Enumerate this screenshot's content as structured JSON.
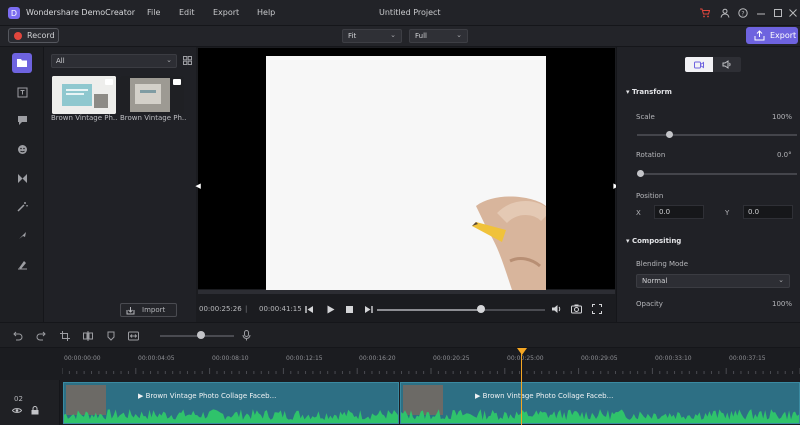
{
  "app": {
    "name": "Wondershare DemoCreator",
    "logo_letter": "D"
  },
  "menu": [
    "File",
    "Edit",
    "Export",
    "Help"
  ],
  "window": {
    "title": "Untitled Project"
  },
  "toolbar": {
    "record_label": "Record",
    "fit_value": "Fit",
    "quality_value": "Full",
    "export_label": "Export"
  },
  "media": {
    "filter_value": "All",
    "items": [
      {
        "label": "Brown Vintage Ph..."
      },
      {
        "label": "Brown Vintage Ph..."
      }
    ],
    "import_label": "Import"
  },
  "preview": {
    "current_time": "00:00:25:26",
    "separator": "|",
    "total_time": "00:00:41:15",
    "scrub_progress": 0.62
  },
  "properties": {
    "transform_label": "Transform",
    "scale_label": "Scale",
    "scale_value": "100%",
    "scale_level": 0.2,
    "rotation_label": "Rotation",
    "rotation_value": "0.0°",
    "rotation_level": 0.0,
    "position_label": "Position",
    "x_label": "X",
    "x_value": "0.0",
    "y_label": "Y",
    "y_value": "0.0",
    "compositing_label": "Compositing",
    "blending_label": "Blending Mode",
    "blending_value": "Normal",
    "opacity_label": "Opacity",
    "opacity_value": "100%"
  },
  "timeline": {
    "ticks": [
      "00:00:00:00",
      "00:00:04:05",
      "00:00:08:10",
      "00:00:12:15",
      "00:00:16:20",
      "00:00:20:25",
      "00:00:25:00",
      "00:00:29:05",
      "00:00:33:10",
      "00:00:37:15"
    ],
    "track_number": "02",
    "clips": [
      {
        "title": "Brown Vintage Photo Collage Faceb..."
      },
      {
        "title": "Brown Vintage Photo Collage Faceb..."
      }
    ],
    "zoom_level": 0.55
  },
  "colors": {
    "accent": "#6e63df",
    "record": "#e1463d",
    "playhead": "#f5a623",
    "clip": "#2d6f84",
    "wave": "#2fc36b"
  }
}
